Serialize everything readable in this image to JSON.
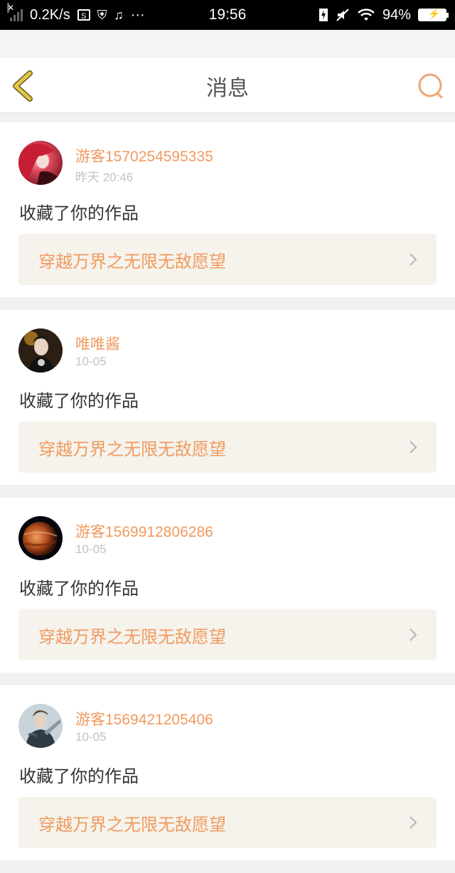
{
  "status_bar": {
    "speed": "0.2K/s",
    "time": "19:56",
    "battery": "94%",
    "more": "···"
  },
  "header": {
    "title": "消息"
  },
  "messages": [
    {
      "username": "游客1570254595335",
      "time": "昨天 20:46",
      "text": "收藏了你的作品",
      "work_title": "穿越万界之无限无敌愿望"
    },
    {
      "username": "唯唯酱",
      "time": "10-05",
      "text": "收藏了你的作品",
      "work_title": "穿越万界之无限无敌愿望"
    },
    {
      "username": "游客1569912806286",
      "time": "10-05",
      "text": "收藏了你的作品",
      "work_title": "穿越万界之无限无敌愿望"
    },
    {
      "username": "游客1569421205406",
      "time": "10-05",
      "text": "收藏了你的作品",
      "work_title": "穿越万界之无限无敌愿望"
    }
  ],
  "colors": {
    "accent": "#f09a5e",
    "back_icon": "#e2c54a",
    "search_icon": "#f0a574",
    "card_link_bg": "#f5f3ec"
  },
  "icons": {
    "back": "chevron-left-icon",
    "search": "search-icon",
    "row_arrow": "chevron-right-icon"
  }
}
